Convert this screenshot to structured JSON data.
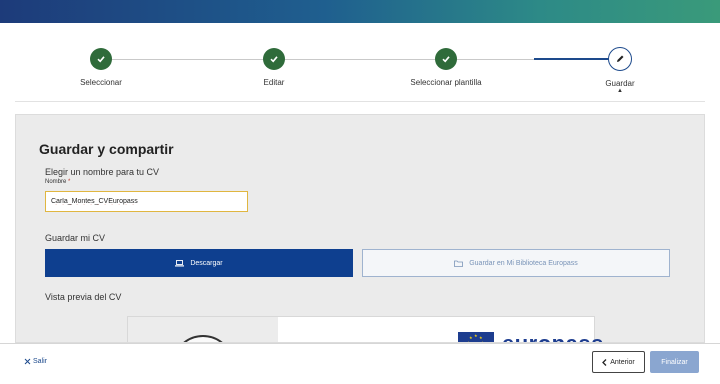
{
  "steps": [
    {
      "label": "Seleccionar",
      "state": "done"
    },
    {
      "label": "Editar",
      "state": "done"
    },
    {
      "label": "Seleccionar plantilla",
      "state": "done"
    },
    {
      "label": "Guardar",
      "state": "current"
    }
  ],
  "panel": {
    "title": "Guardar y compartir",
    "name_section_label": "Elegir un nombre para tu CV",
    "name_field_label": "Nombre",
    "name_required_mark": "*",
    "name_value": "Carla_Montes_CVEuropass",
    "save_label": "Guardar mi CV",
    "download_label": "Descargar",
    "library_label": "Guardar en Mi Biblioteca Europass",
    "preview_label": "Vista previa del CV",
    "preview_brand": "europass"
  },
  "footer": {
    "exit_label": "Salir",
    "prev_label": "Anterior",
    "finish_label": "Finalizar"
  },
  "colors": {
    "accent": "#0e3f8f",
    "done": "#2f6b3a",
    "disabled": "#8aa6d0"
  },
  "icons": {
    "done_step": "check-icon",
    "current_step": "pencil-icon",
    "download": "laptop-icon",
    "library": "folder-icon",
    "exit": "close-icon",
    "prev": "chevron-left-icon"
  }
}
